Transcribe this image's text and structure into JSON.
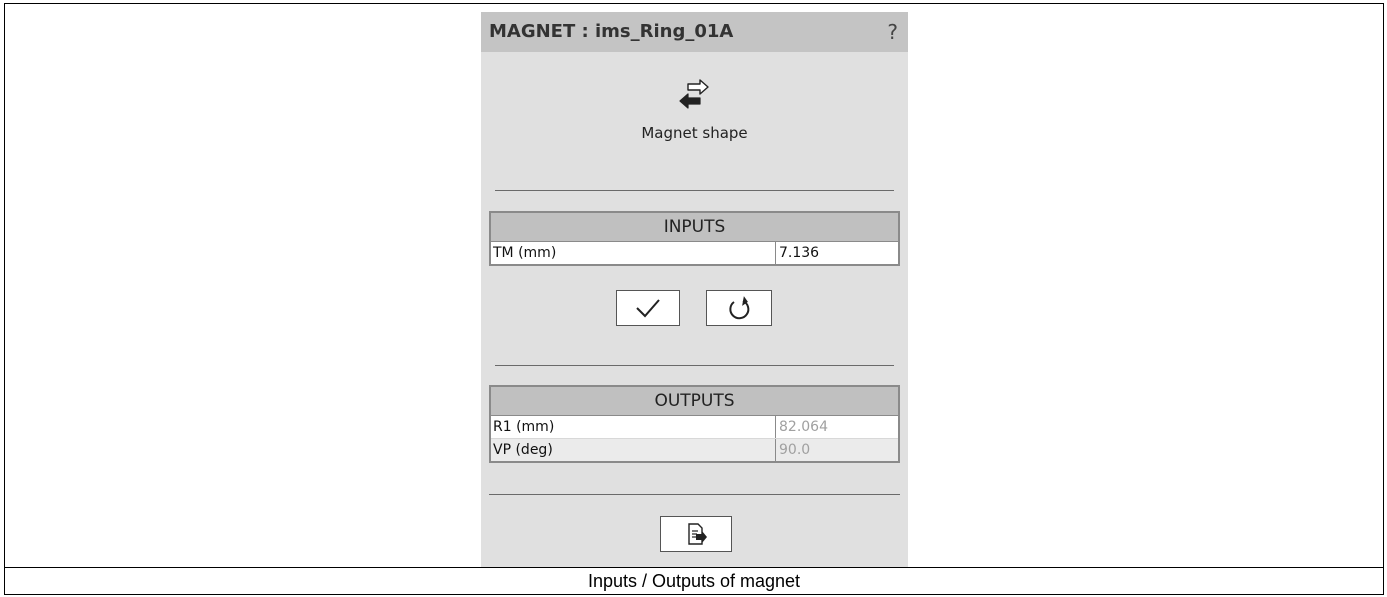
{
  "panel": {
    "title": "MAGNET : ims_Ring_01A",
    "help_label": "?",
    "shape_icon": "swap-arrows-icon",
    "shape_label": "Magnet shape"
  },
  "inputs": {
    "header": "INPUTS",
    "rows": [
      {
        "label": "TM (mm)",
        "value": "7.136"
      }
    ],
    "apply_icon": "checkmark-icon",
    "reset_icon": "undo-icon"
  },
  "outputs": {
    "header": "OUTPUTS",
    "rows": [
      {
        "label": "R1 (mm)",
        "value": "82.064"
      },
      {
        "label": "VP (deg)",
        "value": "90.0"
      }
    ],
    "export_icon": "export-document-icon"
  },
  "caption": "Inputs / Outputs of magnet"
}
